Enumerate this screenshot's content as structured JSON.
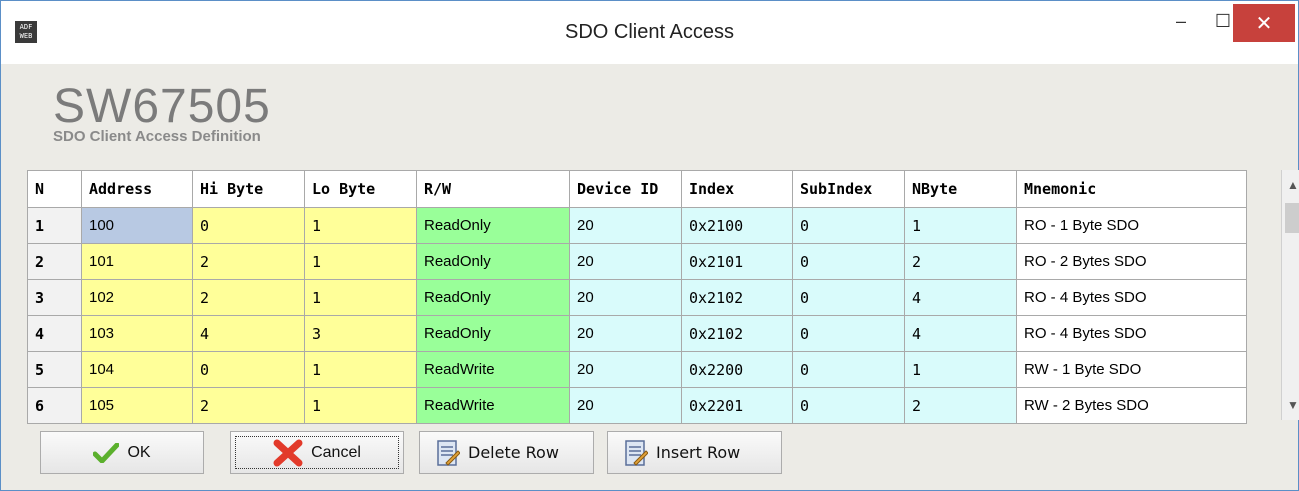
{
  "window": {
    "title": "SDO Client Access",
    "app_icon_text": "ADF\nWEB",
    "minimize_glyph": "–",
    "maximize_glyph": "☐",
    "close_glyph": "✕"
  },
  "header": {
    "product": "SW67505",
    "subtitle": "SDO Client Access Definition"
  },
  "table": {
    "columns": [
      "N",
      "Address",
      "Hi Byte",
      "Lo Byte",
      "R/W",
      "Device ID",
      "Index",
      "SubIndex",
      "NByte",
      "Mnemonic"
    ],
    "rows": [
      [
        "1",
        "100",
        "0",
        "1",
        "ReadOnly",
        "20",
        "0x2100",
        "0",
        "1",
        "RO - 1 Byte SDO"
      ],
      [
        "2",
        "101",
        "2",
        "1",
        "ReadOnly",
        "20",
        "0x2101",
        "0",
        "2",
        "RO - 2 Bytes SDO"
      ],
      [
        "3",
        "102",
        "2",
        "1",
        "ReadOnly",
        "20",
        "0x2102",
        "0",
        "4",
        "RO - 4 Bytes SDO"
      ],
      [
        "4",
        "103",
        "4",
        "3",
        "ReadOnly",
        "20",
        "0x2102",
        "0",
        "4",
        "RO - 4 Bytes SDO"
      ],
      [
        "5",
        "104",
        "0",
        "1",
        "ReadWrite",
        "20",
        "0x2200",
        "0",
        "1",
        "RW - 1 Byte SDO"
      ],
      [
        "6",
        "105",
        "2",
        "1",
        "ReadWrite",
        "20",
        "0x2201",
        "0",
        "2",
        "RW - 2 Bytes SDO"
      ]
    ]
  },
  "buttons": {
    "ok": "OK",
    "cancel": "Cancel",
    "delete_row": "Delete Row",
    "insert_row": "Insert Row"
  },
  "colors": {
    "yellow_cells": "#ffff99",
    "green_cells": "#99ff99",
    "cyan_cells": "#d9fbfb",
    "selected_cell": "#b8c9e3",
    "close_button": "#c7413c"
  }
}
